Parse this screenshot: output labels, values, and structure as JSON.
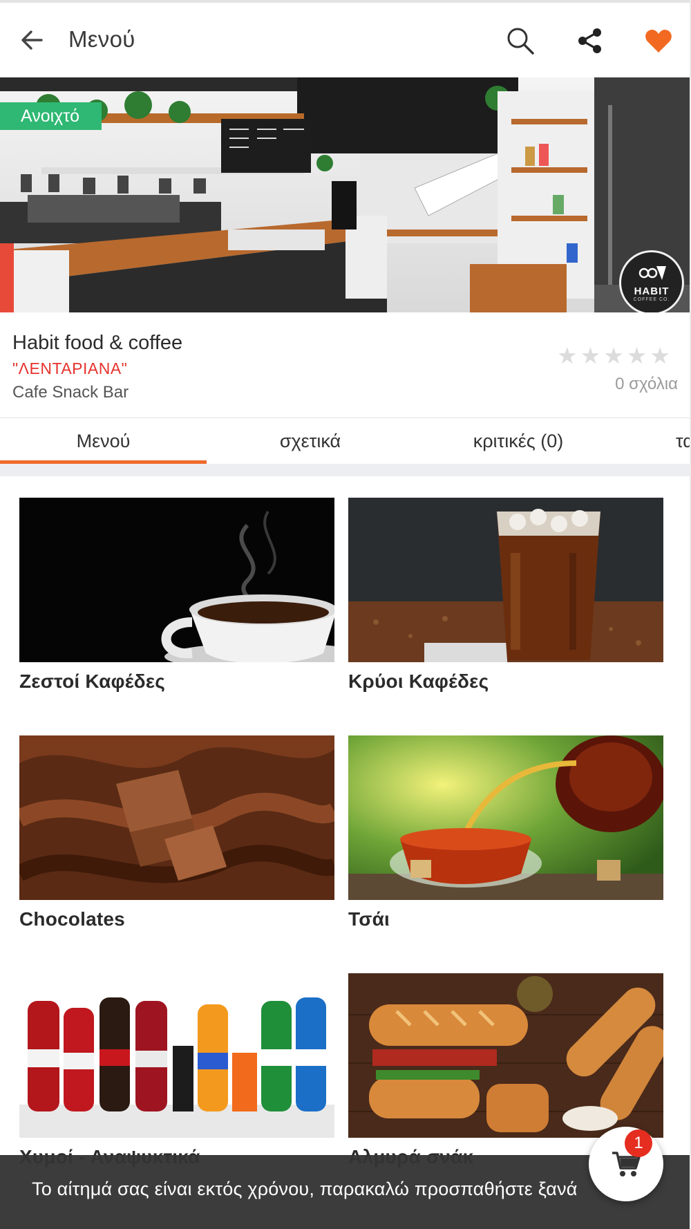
{
  "app_bar": {
    "title": "Μενού",
    "back_icon": "arrow-left-icon",
    "search_icon": "search-icon",
    "share_icon": "share-icon",
    "favorite_icon": "heart-icon",
    "favorite_color": "#f26a22"
  },
  "hero": {
    "status_badge": "Ανοιχτό",
    "status_color": "#2fb873",
    "logo_text": "HABIT",
    "logo_subtext": "COFFEE CO."
  },
  "store": {
    "name": "Habit food & coffee",
    "area": "\"ΛΕΝΤΑΡΙΑΝΑ\"",
    "category": "Cafe Snack Bar",
    "rating": 0,
    "rating_max": 5,
    "reviews_label": "0 σχόλια"
  },
  "tabs": [
    {
      "label": "Μενού",
      "active": true
    },
    {
      "label": "σχετικά",
      "active": false
    },
    {
      "label": "κριτικές (0)",
      "active": false
    },
    {
      "label": "τα",
      "active": false
    }
  ],
  "accent_color": "#ef6b2b",
  "menu": [
    {
      "label": "Ζεστοί Καφέδες"
    },
    {
      "label": "Κρύοι Καφέδες"
    },
    {
      "label": "Chocolates"
    },
    {
      "label": "Τσάι"
    },
    {
      "label": "Χυμοί - Αναψυκτικά"
    },
    {
      "label": "Αλμυρά σνάκ"
    }
  ],
  "snackbar": {
    "message": "Το αίτημά σας είναι εκτός χρόνου, παρακαλώ προσπαθήστε ξανά"
  },
  "cart": {
    "icon": "cart-icon",
    "count": "1"
  }
}
